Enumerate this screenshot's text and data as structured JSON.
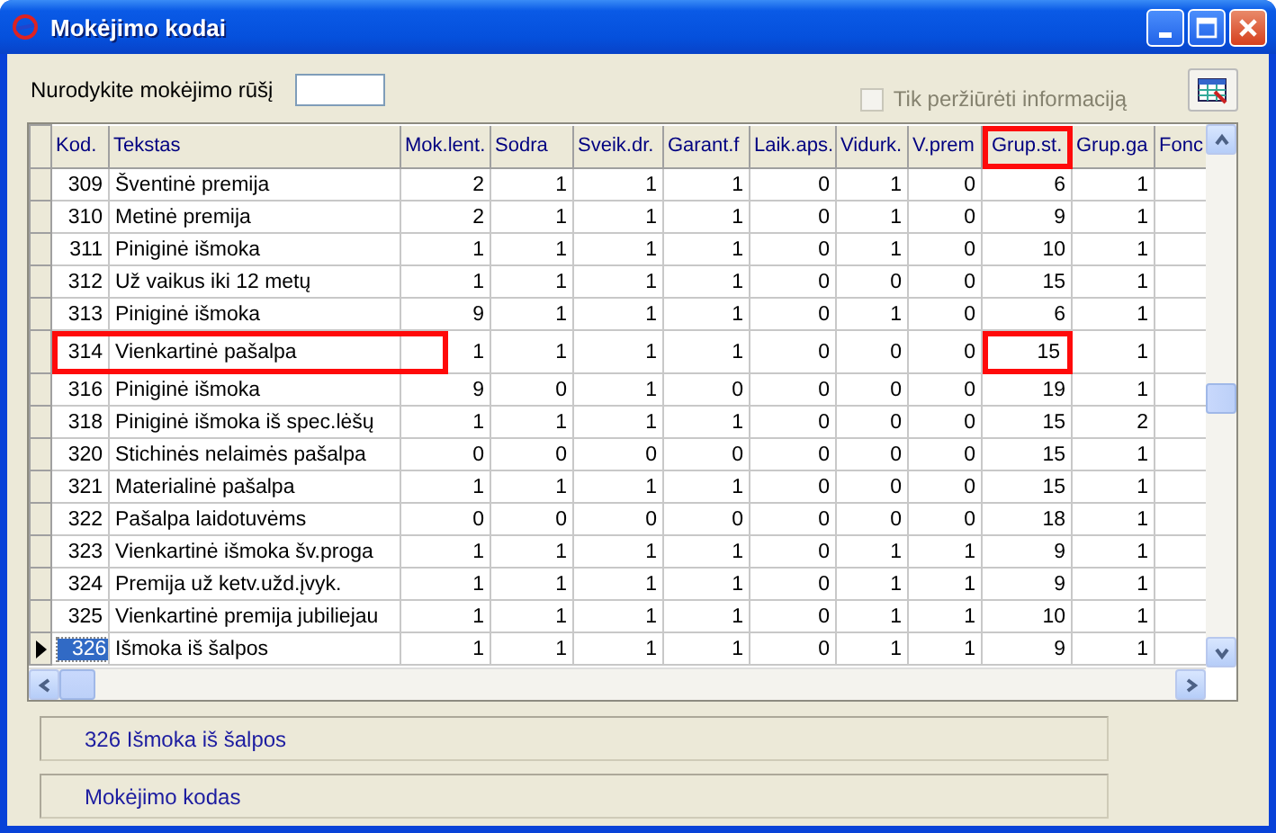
{
  "window": {
    "title": "Mokėjimo kodai"
  },
  "filter": {
    "label": "Nurodykite mokėjimo rūšį"
  },
  "view_only": {
    "label": "Tik peržiūrėti informaciją",
    "checked": false,
    "disabled": true
  },
  "table": {
    "columns": [
      {
        "label": "Kod.",
        "marked": false
      },
      {
        "label": "Tekstas",
        "marked": false
      },
      {
        "label": "Mok.lent.",
        "marked": false
      },
      {
        "label": "Sodra",
        "marked": false
      },
      {
        "label": "Sveik.dr.",
        "marked": false
      },
      {
        "label": "Garant.f",
        "marked": false
      },
      {
        "label": "Laik.aps.",
        "marked": false
      },
      {
        "label": "Vidurk.",
        "marked": false
      },
      {
        "label": "V.prem",
        "marked": false
      },
      {
        "label": "Grup.st.",
        "marked": true
      },
      {
        "label": "Grup.ga",
        "marked": false
      },
      {
        "label": "Fonc",
        "marked": false
      }
    ],
    "rows": [
      {
        "cells": [
          "309",
          "Šventinė premija",
          "2",
          "1",
          "1",
          "1",
          "0",
          "1",
          "0",
          "6",
          "1"
        ],
        "selected": false,
        "marked": false
      },
      {
        "cells": [
          "310",
          "Metinė premija",
          "2",
          "1",
          "1",
          "1",
          "0",
          "1",
          "0",
          "9",
          "1"
        ],
        "selected": false,
        "marked": false
      },
      {
        "cells": [
          "311",
          "Piniginė išmoka",
          "1",
          "1",
          "1",
          "1",
          "0",
          "1",
          "0",
          "10",
          "1"
        ],
        "selected": false,
        "marked": false
      },
      {
        "cells": [
          "312",
          "Už vaikus iki 12 metų",
          "1",
          "1",
          "1",
          "1",
          "0",
          "0",
          "0",
          "15",
          "1"
        ],
        "selected": false,
        "marked": false
      },
      {
        "cells": [
          "313",
          "Piniginė išmoka",
          "9",
          "1",
          "1",
          "1",
          "0",
          "1",
          "0",
          "6",
          "1"
        ],
        "selected": false,
        "marked": false
      },
      {
        "cells": [
          "314",
          "Vienkartinė pašalpa",
          "1",
          "1",
          "1",
          "1",
          "0",
          "0",
          "0",
          "15",
          "1"
        ],
        "selected": false,
        "marked": true
      },
      {
        "cells": [
          "316",
          "Piniginė išmoka",
          "9",
          "0",
          "1",
          "0",
          "0",
          "0",
          "0",
          "19",
          "1"
        ],
        "selected": false,
        "marked": false
      },
      {
        "cells": [
          "318",
          "Piniginė išmoka iš spec.lėšų",
          "1",
          "1",
          "1",
          "1",
          "0",
          "0",
          "0",
          "15",
          "2"
        ],
        "selected": false,
        "marked": false
      },
      {
        "cells": [
          "320",
          "Stichinės nelaimės pašalpa",
          "0",
          "0",
          "0",
          "0",
          "0",
          "0",
          "0",
          "15",
          "1"
        ],
        "selected": false,
        "marked": false
      },
      {
        "cells": [
          "321",
          "Materialinė pašalpa",
          "1",
          "1",
          "1",
          "1",
          "0",
          "0",
          "0",
          "15",
          "1"
        ],
        "selected": false,
        "marked": false
      },
      {
        "cells": [
          "322",
          "Pašalpa laidotuvėms",
          "0",
          "0",
          "0",
          "0",
          "0",
          "0",
          "0",
          "18",
          "1"
        ],
        "selected": false,
        "marked": false
      },
      {
        "cells": [
          "323",
          "Vienkartinė išmoka šv.proga",
          "1",
          "1",
          "1",
          "1",
          "0",
          "1",
          "1",
          "9",
          "1"
        ],
        "selected": false,
        "marked": false
      },
      {
        "cells": [
          "324",
          "Premija už ketv.užd.įvyk.",
          "1",
          "1",
          "1",
          "1",
          "0",
          "1",
          "1",
          "9",
          "1"
        ],
        "selected": false,
        "marked": false
      },
      {
        "cells": [
          "325",
          "Vienkartinė premija jubiliejau",
          "1",
          "1",
          "1",
          "1",
          "0",
          "1",
          "1",
          "10",
          "1"
        ],
        "selected": false,
        "marked": false
      },
      {
        "cells": [
          "326",
          "Išmoka iš šalpos",
          "1",
          "1",
          "1",
          "1",
          "0",
          "1",
          "1",
          "9",
          "1"
        ],
        "selected": true,
        "marked": false
      }
    ]
  },
  "status_panels": [
    "326 Išmoka iš šalpos",
    "Mokėjimo kodas"
  ]
}
